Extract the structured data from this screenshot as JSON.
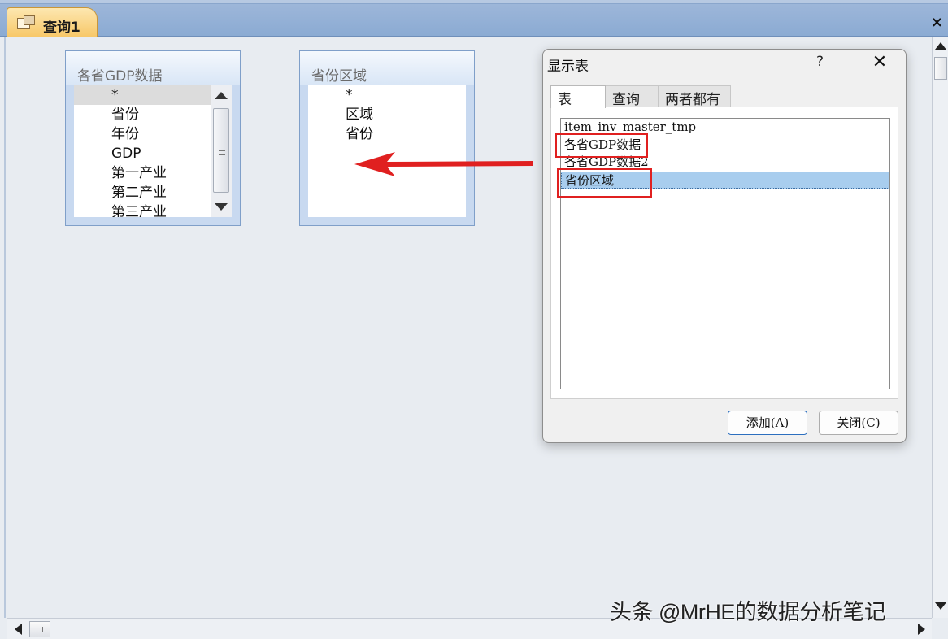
{
  "document_tab": {
    "label": "查询1",
    "icon": "query-icon"
  },
  "close_label": "×",
  "tables": [
    {
      "title": "各省GDP数据",
      "fields": [
        "*",
        "省份",
        "年份",
        "GDP",
        "第一产业",
        "第二产业",
        "第三产业"
      ]
    },
    {
      "title": "省份区域",
      "fields": [
        "*",
        "区域",
        "省份"
      ]
    }
  ],
  "dialog": {
    "title": "显示表",
    "help": "?",
    "close": "✕",
    "tabs": [
      "表",
      "查询",
      "两者都有"
    ],
    "items": [
      "item_inv_master_tmp",
      "各省GDP数据",
      "各省GDP数据2",
      "省份区域"
    ],
    "selected_item": "省份区域",
    "add_button": "添加(A)",
    "close_button": "关闭(C)"
  },
  "watermark": "头条 @MrHE的数据分析笔记",
  "colors": {
    "accent": "#a8cdee",
    "highlight_box": "#e02020",
    "arrow": "#e02020"
  }
}
